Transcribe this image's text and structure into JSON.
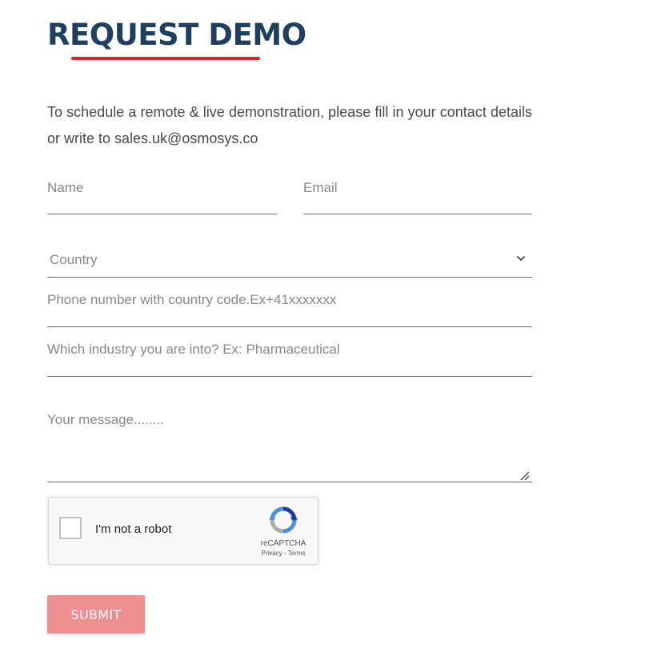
{
  "header": {
    "title": "REQUEST DEMO",
    "title_color": "#1f3f5c",
    "underline_color": "#d9242f"
  },
  "intro": {
    "text": "To schedule a remote & live demonstration, please fill in your contact details or write to sales.uk@osmosys.co"
  },
  "form": {
    "name": {
      "placeholder": "Name",
      "value": ""
    },
    "email": {
      "placeholder": "Email",
      "value": ""
    },
    "country": {
      "selected": "Country",
      "icon": "chevron-down-icon"
    },
    "phone": {
      "placeholder": "Phone number with country code.Ex+41xxxxxxx",
      "value": ""
    },
    "industry": {
      "placeholder": "Which industry you are into? Ex: Pharmaceutical",
      "value": ""
    },
    "message": {
      "placeholder": "Your message........",
      "value": ""
    }
  },
  "recaptcha": {
    "label": "I'm not a robot",
    "brand": "reCAPTCHA",
    "privacy": "Privacy",
    "separator": " - ",
    "terms": "Terms",
    "checked": false
  },
  "submit": {
    "label": "SUBMIT",
    "color": "#ef8f91"
  }
}
